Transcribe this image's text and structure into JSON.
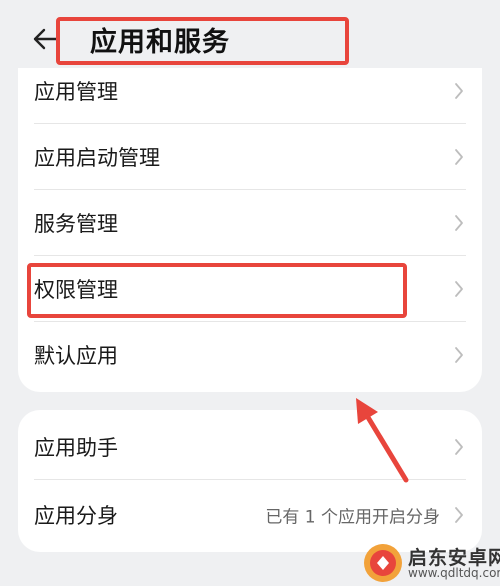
{
  "header": {
    "title": "应用和服务",
    "back_icon": "arrow-left-icon"
  },
  "group1": {
    "items": [
      {
        "label": "应用管理"
      },
      {
        "label": "应用启动管理"
      },
      {
        "label": "服务管理"
      },
      {
        "label": "权限管理"
      },
      {
        "label": "默认应用"
      }
    ]
  },
  "group2": {
    "items": [
      {
        "label": "应用助手",
        "value": ""
      },
      {
        "label": "应用分身",
        "value": "已有 1 个应用开启分身"
      }
    ]
  },
  "annotation": {
    "color": "#e8453c"
  },
  "watermark": {
    "text": "启东安卓网",
    "url": "www.qdltdq.com",
    "logo_icon": "app-logo-icon"
  }
}
